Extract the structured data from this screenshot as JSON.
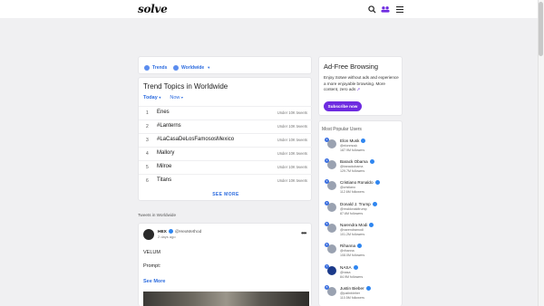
{
  "header": {
    "logo": "solve"
  },
  "filters": {
    "trends_label": "Trends",
    "region_label": "Worldwide"
  },
  "trends": {
    "title": "Trend Topics in Worldwide",
    "tabs": [
      "Today",
      "Now"
    ],
    "items": [
      {
        "rank": "1",
        "name": "Enes",
        "count": "Under 10K tweets"
      },
      {
        "rank": "2",
        "name": "#Lanterns",
        "count": "Under 10K tweets"
      },
      {
        "rank": "3",
        "name": "#LaCasaDeLosFamososMexico",
        "count": "Under 10K tweets"
      },
      {
        "rank": "4",
        "name": "Mallory",
        "count": "Under 10K tweets"
      },
      {
        "rank": "5",
        "name": "Milroe",
        "count": "Under 10K tweets"
      },
      {
        "rank": "6",
        "name": "Titans",
        "count": "Under 10K tweets"
      }
    ],
    "see_more": "SEE MORE"
  },
  "ad": {
    "title": "Ad-Free Browsing",
    "text": "Enjoy Sotwe without ads and experience a more enjoyable browsing. More content, zero ads",
    "button": "Subscribe now"
  },
  "popular": {
    "title": "Most Popular Users",
    "users": [
      {
        "rank": "1",
        "name": "Elon Musk",
        "handle": "@elonmusk",
        "followers": "187.9M followers"
      },
      {
        "rank": "2",
        "name": "Barack Obama",
        "handle": "@barackobama",
        "followers": "129.7M followers"
      },
      {
        "rank": "3",
        "name": "Cristiano Ronaldo",
        "handle": "@cristiano",
        "followers": "112.6M followers"
      },
      {
        "rank": "4",
        "name": "Donald J. Trump",
        "handle": "@realdonaldtrump",
        "followers": "87.6M followers"
      },
      {
        "rank": "5",
        "name": "Narendra Modi",
        "handle": "@narendramodi",
        "followers": "101.2M followers"
      },
      {
        "rank": "6",
        "name": "Rihanna",
        "handle": "@rihanna",
        "followers": "108.0M followers"
      },
      {
        "rank": "7",
        "name": "NASA",
        "handle": "@nasa",
        "followers": "84.9M followers"
      },
      {
        "rank": "8",
        "name": "Justin Bieber",
        "handle": "@justinbieber",
        "followers": "110.5M followers"
      }
    ]
  },
  "tweets": {
    "label": "Tweets in Worldwide",
    "post": {
      "name": "HEX",
      "handle": "@HexMethod",
      "time": "2 days ago",
      "line1": "VELUM",
      "line2": "Prompt:",
      "see_more": "See More"
    }
  },
  "colors": {
    "accent": "#2d6cdf",
    "subscribe": "#6e2be0",
    "background": "#f0f0f2"
  }
}
